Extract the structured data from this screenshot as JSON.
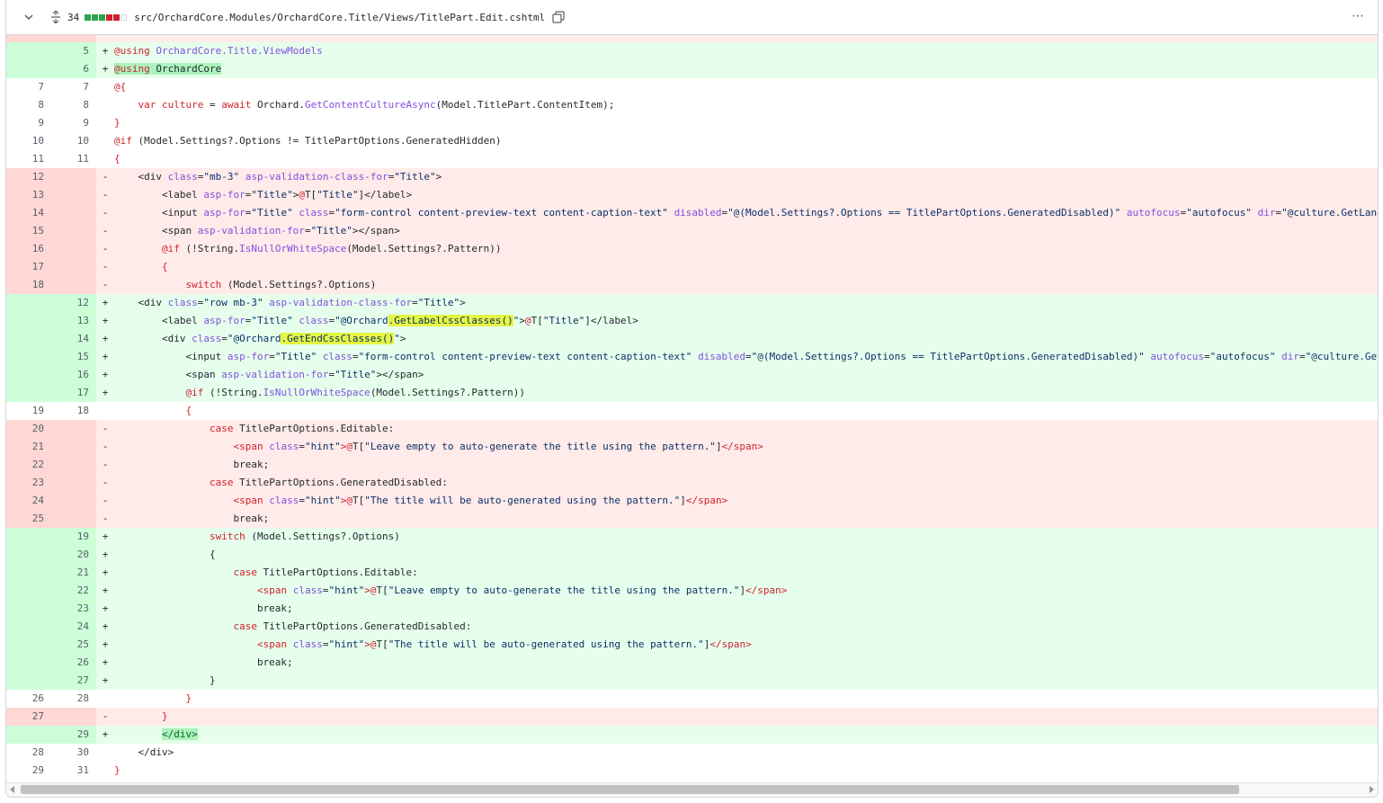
{
  "header": {
    "lines_changed": "34",
    "file_path": "src/OrchardCore.Modules/OrchardCore.Title/Views/TitlePart.Edit.cshtml",
    "diffstat": [
      "green",
      "green",
      "green",
      "red",
      "red",
      "gray"
    ],
    "colors": {
      "green": "#2da44e",
      "red": "#cf222e",
      "gray": "#d0d7de"
    },
    "menu_label": "⋯"
  },
  "lines": [
    {
      "type": "hunk",
      "old": "",
      "new": "",
      "sign": "",
      "code": ""
    },
    {
      "type": "add",
      "old": "",
      "new": "5",
      "sign": "+",
      "code": ""
    },
    {
      "type": "add",
      "old": "",
      "new": "6",
      "sign": "+",
      "code": ""
    },
    {
      "type": "ctx",
      "old": "7",
      "new": "7",
      "sign": "",
      "code": ""
    },
    {
      "type": "ctx",
      "old": "8",
      "new": "8",
      "sign": "",
      "code": ""
    },
    {
      "type": "ctx",
      "old": "9",
      "new": "9",
      "sign": "",
      "code": ""
    },
    {
      "type": "ctx",
      "old": "10",
      "new": "10",
      "sign": "",
      "code": ""
    },
    {
      "type": "ctx",
      "old": "11",
      "new": "11",
      "sign": "",
      "code": ""
    },
    {
      "type": "del",
      "old": "12",
      "new": "",
      "sign": "-",
      "code": ""
    },
    {
      "type": "del",
      "old": "13",
      "new": "",
      "sign": "-",
      "code": ""
    },
    {
      "type": "del",
      "old": "14",
      "new": "",
      "sign": "-",
      "code": ""
    },
    {
      "type": "del",
      "old": "15",
      "new": "",
      "sign": "-",
      "code": ""
    },
    {
      "type": "del",
      "old": "16",
      "new": "",
      "sign": "-",
      "code": ""
    },
    {
      "type": "del",
      "old": "17",
      "new": "",
      "sign": "-",
      "code": ""
    },
    {
      "type": "del",
      "old": "18",
      "new": "",
      "sign": "-",
      "code": ""
    },
    {
      "type": "add",
      "old": "",
      "new": "12",
      "sign": "+",
      "code": ""
    },
    {
      "type": "add",
      "old": "",
      "new": "13",
      "sign": "+",
      "code": ""
    },
    {
      "type": "add",
      "old": "",
      "new": "14",
      "sign": "+",
      "code": ""
    },
    {
      "type": "add",
      "old": "",
      "new": "15",
      "sign": "+",
      "code": ""
    },
    {
      "type": "add",
      "old": "",
      "new": "16",
      "sign": "+",
      "code": ""
    },
    {
      "type": "add",
      "old": "",
      "new": "17",
      "sign": "+",
      "code": ""
    },
    {
      "type": "ctx",
      "old": "19",
      "new": "18",
      "sign": "",
      "code": ""
    },
    {
      "type": "del",
      "old": "20",
      "new": "",
      "sign": "-",
      "code": ""
    },
    {
      "type": "del",
      "old": "21",
      "new": "",
      "sign": "-",
      "code": ""
    },
    {
      "type": "del",
      "old": "22",
      "new": "",
      "sign": "-",
      "code": ""
    },
    {
      "type": "del",
      "old": "23",
      "new": "",
      "sign": "-",
      "code": ""
    },
    {
      "type": "del",
      "old": "24",
      "new": "",
      "sign": "-",
      "code": ""
    },
    {
      "type": "del",
      "old": "25",
      "new": "",
      "sign": "-",
      "code": ""
    },
    {
      "type": "add",
      "old": "",
      "new": "19",
      "sign": "+",
      "code": ""
    },
    {
      "type": "add",
      "old": "",
      "new": "20",
      "sign": "+",
      "code": ""
    },
    {
      "type": "add",
      "old": "",
      "new": "21",
      "sign": "+",
      "code": ""
    },
    {
      "type": "add",
      "old": "",
      "new": "22",
      "sign": "+",
      "code": ""
    },
    {
      "type": "add",
      "old": "",
      "new": "23",
      "sign": "+",
      "code": ""
    },
    {
      "type": "add",
      "old": "",
      "new": "24",
      "sign": "+",
      "code": ""
    },
    {
      "type": "add",
      "old": "",
      "new": "25",
      "sign": "+",
      "code": ""
    },
    {
      "type": "add",
      "old": "",
      "new": "26",
      "sign": "+",
      "code": ""
    },
    {
      "type": "add",
      "old": "",
      "new": "27",
      "sign": "+",
      "code": ""
    },
    {
      "type": "ctx",
      "old": "26",
      "new": "28",
      "sign": "",
      "code": ""
    },
    {
      "type": "del",
      "old": "27",
      "new": "",
      "sign": "-",
      "code": ""
    },
    {
      "type": "add",
      "old": "",
      "new": "29",
      "sign": "+",
      "code": ""
    },
    {
      "type": "ctx",
      "old": "28",
      "new": "30",
      "sign": "",
      "code": ""
    },
    {
      "type": "ctx",
      "old": "29",
      "new": "31",
      "sign": "",
      "code": ""
    }
  ],
  "code_html": [
    "",
    "<span class=\"at\">@</span><span class=\"kw\">using</span> <span class=\"tp\">OrchardCore.Title.ViewModels</span>",
    "<span class=\"hlg\"><span class=\"at\">@</span><span class=\"kw\">using</span> OrchardCore</span>",
    "<span class=\"at\">@{</span>",
    "    <span class=\"kw\">var</span> <span class=\"kw\">culture</span> = <span class=\"kw\">await</span> Orchard.<span class=\"fn\">GetContentCultureAsync</span>(Model.TitlePart.ContentItem);",
    "<span class=\"at\">}</span>",
    "<span class=\"at\">@</span><span class=\"kw\">if</span> (Model.Settings?.Options != TitlePartOptions.GeneratedHidden)",
    "<span class=\"at\">{</span>",
    "    &lt;div <span class=\"attr\">class</span>=<span class=\"str\">\"mb-3\"</span> <span class=\"attr\">asp-validation-class-for</span>=<span class=\"str\">\"Title\"</span>&gt;",
    "        &lt;label <span class=\"attr\">asp-for</span>=<span class=\"str\">\"Title\"</span>&gt;<span class=\"at\">@</span>T[<span class=\"str\">\"Title\"</span>]&lt;/label&gt;",
    "        &lt;input <span class=\"attr\">asp-for</span>=<span class=\"str\">\"Title\"</span> <span class=\"attr\">class</span>=<span class=\"str\">\"form-control content-preview-text content-caption-text\"</span> <span class=\"attr\">disabled</span>=<span class=\"str\">\"@(Model.Settings?.Options == TitlePartOptions.GeneratedDisabled)\"</span> <span class=\"attr\">autofocus</span>=<span class=\"str\">\"autofocus\"</span> <span class=\"attr\">dir</span>=<span class=\"str\">\"@culture.GetLang</span>",
    "        &lt;span <span class=\"attr\">asp-validation-for</span>=<span class=\"str\">\"Title\"</span>&gt;&lt;/span&gt;",
    "        <span class=\"at\">@</span><span class=\"kw\">if</span> (!String.<span class=\"fn\">IsNullOrWhiteSpace</span>(Model.Settings?.Pattern))",
    "        <span class=\"at\">{</span>",
    "            <span class=\"kw\">switch</span> (Model.Settings?.Options)",
    "    &lt;div <span class=\"attr\">class</span>=<span class=\"str\">\"row mb-3\"</span> <span class=\"attr\">asp-validation-class-for</span>=<span class=\"str\">\"Title\"</span>&gt;",
    "        &lt;label <span class=\"attr\">asp-for</span>=<span class=\"str\">\"Title\"</span> <span class=\"attr\">class</span>=<span class=\"str\">\"@Orchard<span class=\"hl\">.GetLabelCssClasses()</span>\"</span>&gt;<span class=\"at\">@</span>T[<span class=\"str\">\"Title\"</span>]&lt;/label&gt;",
    "        &lt;div <span class=\"attr\">class</span>=<span class=\"str\">\"@Orchard<span class=\"hl\">.GetEndCssClasses()</span>\"</span>&gt;",
    "            &lt;input <span class=\"attr\">asp-for</span>=<span class=\"str\">\"Title\"</span> <span class=\"attr\">class</span>=<span class=\"str\">\"form-control content-preview-text content-caption-text\"</span> <span class=\"attr\">disabled</span>=<span class=\"str\">\"@(Model.Settings?.Options == TitlePartOptions.GeneratedDisabled)\"</span> <span class=\"attr\">autofocus</span>=<span class=\"str\">\"autofocus\"</span> <span class=\"attr\">dir</span>=<span class=\"str\">\"@culture.Get</span>",
    "            &lt;span <span class=\"attr\">asp-validation-for</span>=<span class=\"str\">\"Title\"</span>&gt;&lt;/span&gt;",
    "            <span class=\"at\">@</span><span class=\"kw\">if</span> (!String.<span class=\"fn\">IsNullOrWhiteSpace</span>(Model.Settings?.Pattern))",
    "            <span class=\"at\">{</span>",
    "                <span class=\"kw\">case</span> TitlePartOptions.Editable:",
    "                    <span class=\"at\">&lt;span</span> <span class=\"attr\">class</span>=<span class=\"str\">\"hint\"</span><span class=\"at\">&gt;</span><span class=\"at\">@</span>T[<span class=\"str\">\"Leave empty to auto-generate the title using the pattern.\"</span>]<span class=\"at\">&lt;/span&gt;</span>",
    "                    break;",
    "                <span class=\"kw\">case</span> TitlePartOptions.GeneratedDisabled:",
    "                    <span class=\"at\">&lt;span</span> <span class=\"attr\">class</span>=<span class=\"str\">\"hint\"</span><span class=\"at\">&gt;</span><span class=\"at\">@</span>T[<span class=\"str\">\"The title will be auto-generated using the pattern.\"</span>]<span class=\"at\">&lt;/span&gt;</span>",
    "                    break;",
    "                <span class=\"kw\">switch</span> (Model.Settings?.Options)",
    "                {",
    "                    <span class=\"kw\">case</span> TitlePartOptions.Editable:",
    "                        <span class=\"at\">&lt;span</span> <span class=\"attr\">class</span>=<span class=\"str\">\"hint\"</span><span class=\"at\">&gt;</span><span class=\"at\">@</span>T[<span class=\"str\">\"Leave empty to auto-generate the title using the pattern.\"</span>]<span class=\"at\">&lt;/span&gt;</span>",
    "                        break;",
    "                    <span class=\"kw\">case</span> TitlePartOptions.GeneratedDisabled:",
    "                        <span class=\"at\">&lt;span</span> <span class=\"attr\">class</span>=<span class=\"str\">\"hint\"</span><span class=\"at\">&gt;</span><span class=\"at\">@</span>T[<span class=\"str\">\"The title will be auto-generated using the pattern.\"</span>]<span class=\"at\">&lt;/span&gt;</span>",
    "                        break;",
    "                }",
    "            <span class=\"at\">}</span>",
    "        <span class=\"at\">}</span>",
    "        <span class=\"hlg\"><span class=\"tag\">&lt;/div&gt;</span></span>",
    "    &lt;/div&gt;",
    "<span class=\"at\">}</span>"
  ]
}
